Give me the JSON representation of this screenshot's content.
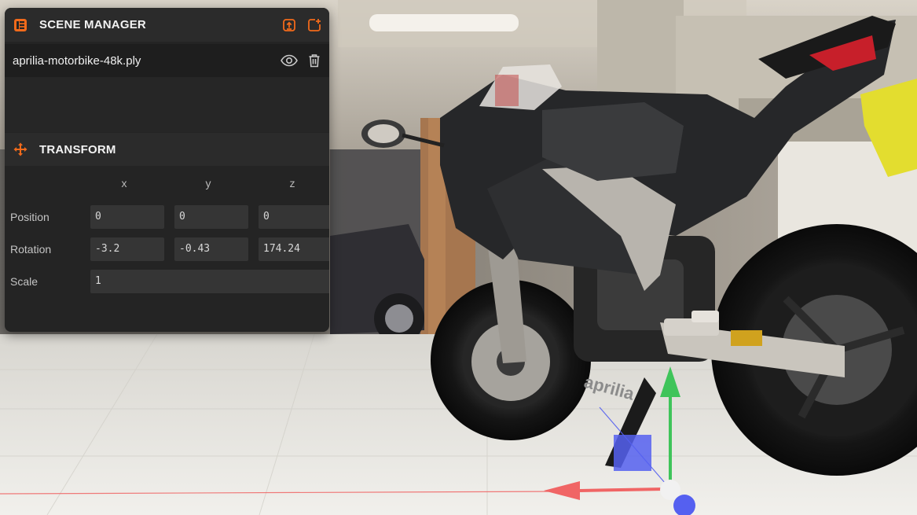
{
  "colors": {
    "accent": "#f26a1b",
    "panel_bg": "#242424",
    "header_bg": "#2b2b2b",
    "input_bg": "#353535",
    "gizmo_x": "#f06565",
    "gizmo_y": "#3fc45a",
    "gizmo_z": "#5560f0"
  },
  "scene_manager": {
    "title": "SCENE MANAGER",
    "header_icons": [
      "scene-manager-icon",
      "import-icon",
      "add-file-icon"
    ],
    "file": {
      "name": "aprilia-motorbike-48k.ply",
      "icons": [
        "eye-icon",
        "trash-icon"
      ]
    }
  },
  "transform": {
    "title": "TRANSFORM",
    "icon": "move-arrows-icon",
    "axes": [
      "x",
      "y",
      "z"
    ],
    "position": {
      "label": "Position",
      "x": "0",
      "y": "0",
      "z": "0"
    },
    "rotation": {
      "label": "Rotation",
      "x": "-3.2",
      "y": "-0.43",
      "z": "174.24"
    },
    "scale": {
      "label": "Scale",
      "value": "1"
    }
  },
  "viewport": {
    "model_branding": "aprilia",
    "gizmo_icons": [
      "x-axis-arrow",
      "y-axis-arrow",
      "z-axis-plane"
    ]
  }
}
